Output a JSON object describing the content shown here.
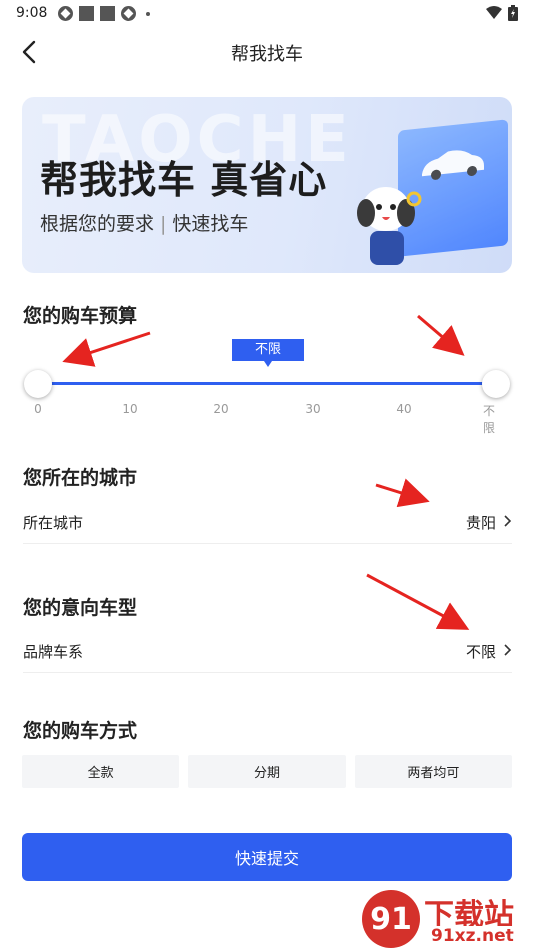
{
  "status_bar": {
    "time": "9:08"
  },
  "nav": {
    "title": "帮我找车"
  },
  "banner": {
    "watermark": "TAOCHE",
    "title": "帮我找车 真省心",
    "subtitle_left": "根据您的要求",
    "subtitle_sep": "|",
    "subtitle_right": "快速找车"
  },
  "budget": {
    "title": "您的购车预算",
    "tooltip": "不限",
    "ticks": [
      "0",
      "10",
      "20",
      "30",
      "40",
      "不限"
    ],
    "range_min": 0,
    "range_max": 1
  },
  "city": {
    "title": "您所在的城市",
    "label": "所在城市",
    "value": "贵阳"
  },
  "car_type": {
    "title": "您的意向车型",
    "label": "品牌车系",
    "value": "不限"
  },
  "payment": {
    "title": "您的购车方式",
    "options": [
      "全款",
      "分期",
      "两者均可"
    ]
  },
  "submit": {
    "label": "快速提交"
  },
  "watermark": {
    "logo": "91",
    "brand": "下载站",
    "url": "91xz.net"
  },
  "colors": {
    "accent": "#2f5ff0",
    "arrow": "#e52420"
  }
}
